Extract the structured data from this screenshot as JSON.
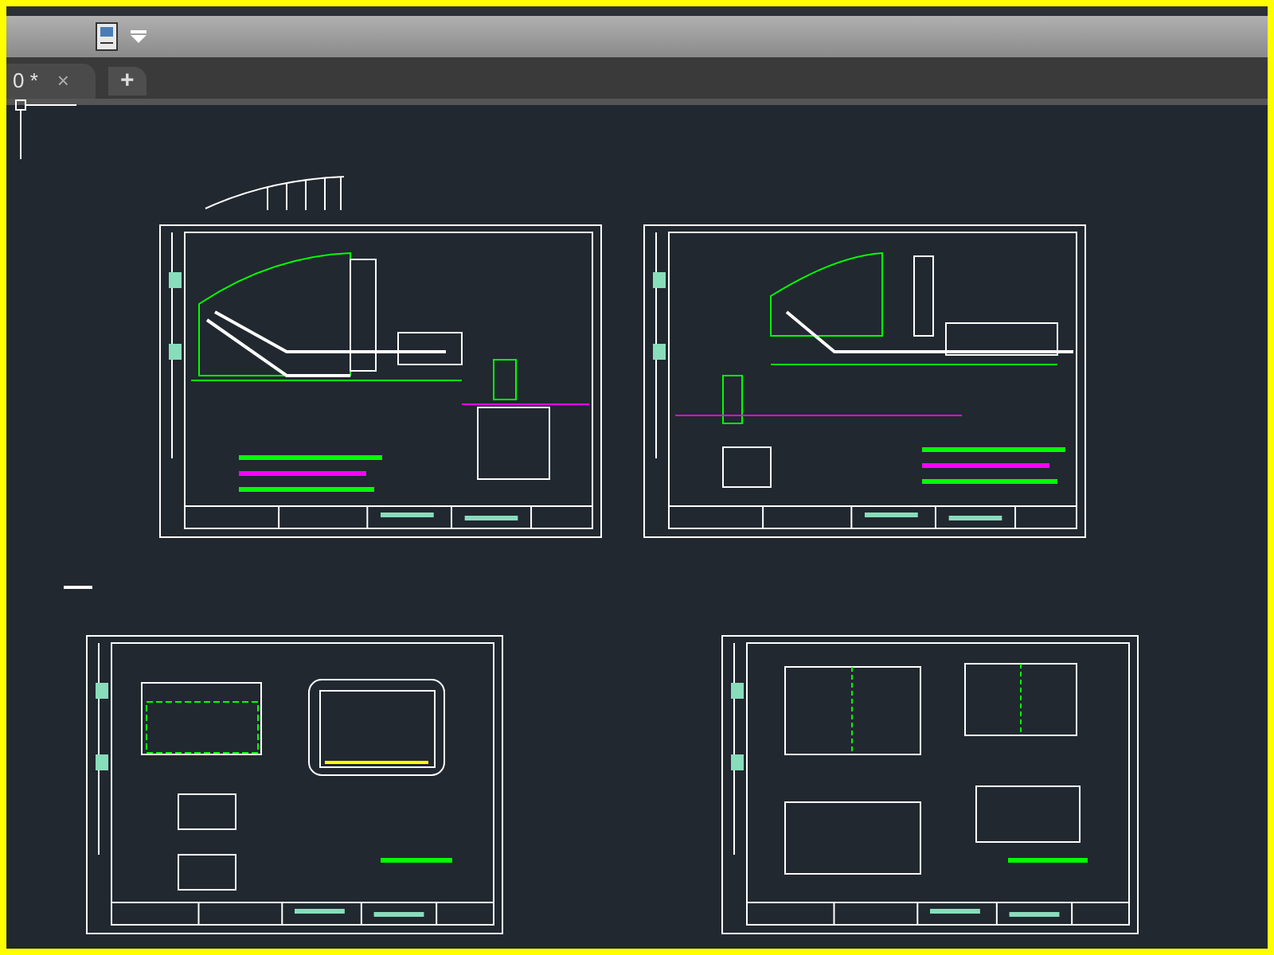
{
  "tabs": [
    {
      "label": "0 *",
      "close": "×",
      "selected": true
    }
  ],
  "new_tab": "+"
}
